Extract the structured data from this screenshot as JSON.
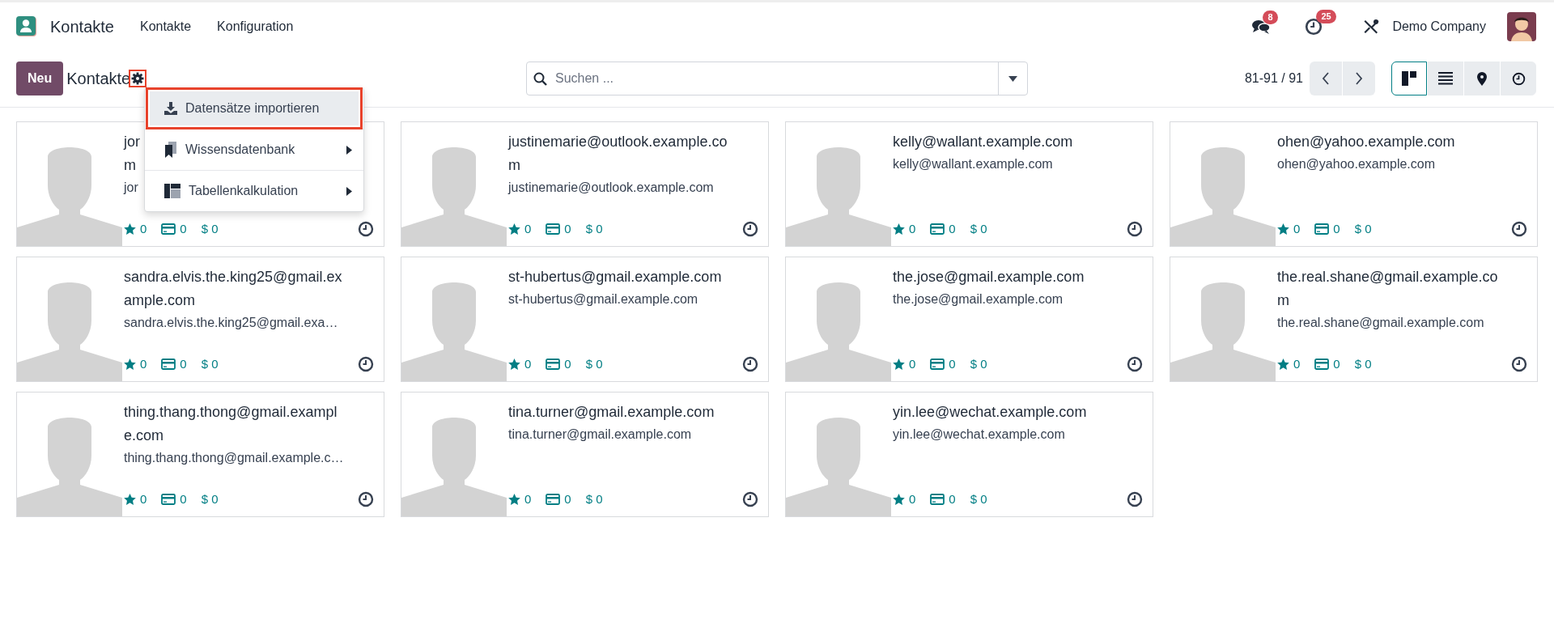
{
  "navbar": {
    "app_name": "Kontakte",
    "menus": [
      "Kontakte",
      "Konfiguration"
    ],
    "messages_badge": "8",
    "activities_badge": "25",
    "company": "Demo Company"
  },
  "control_panel": {
    "new_button": "Neu",
    "breadcrumb": "Kontakte",
    "gear_highlighted": true,
    "actions_menu": [
      {
        "kind": "import",
        "label": "Datensätze importieren",
        "selected": true,
        "highlighted": true,
        "submenu": false
      },
      {
        "kind": "knowledge",
        "label": "Wissensdatenbank",
        "selected": false,
        "highlighted": false,
        "submenu": true
      },
      {
        "kind": "spreadsheet",
        "label": "Tabellenkalkulation",
        "selected": false,
        "highlighted": false,
        "submenu": true
      }
    ],
    "search": {
      "placeholder": "Suchen ..."
    },
    "pager": "81-91 / 91",
    "views": [
      {
        "kind": "kanban",
        "selected": true
      },
      {
        "kind": "list",
        "selected": false
      },
      {
        "kind": "map",
        "selected": false
      },
      {
        "kind": "activity",
        "selected": false
      }
    ]
  },
  "contacts": [
    {
      "title_lines": [
        "jor",
        "m"
      ],
      "email": "jor",
      "stats": [
        {
          "kind": "star",
          "value": "0"
        },
        {
          "kind": "invoice",
          "value": "0"
        },
        {
          "kind": "sales",
          "symbol": "$",
          "value": "0"
        }
      ]
    },
    {
      "title_lines": [
        "justinemarie@outlook.example.co",
        "m"
      ],
      "email": "justinemarie@outlook.example.com",
      "stats": [
        {
          "kind": "star",
          "value": "0"
        },
        {
          "kind": "invoice",
          "value": "0"
        },
        {
          "kind": "sales",
          "symbol": "$",
          "value": "0"
        }
      ]
    },
    {
      "title_lines": [
        "kelly@wallant.example.com"
      ],
      "email": "kelly@wallant.example.com",
      "stats": [
        {
          "kind": "star",
          "value": "0"
        },
        {
          "kind": "invoice",
          "value": "0"
        },
        {
          "kind": "sales",
          "symbol": "$",
          "value": "0"
        }
      ]
    },
    {
      "title_lines": [
        "ohen@yahoo.example.com"
      ],
      "email": "ohen@yahoo.example.com",
      "stats": [
        {
          "kind": "star",
          "value": "0"
        },
        {
          "kind": "invoice",
          "value": "0"
        },
        {
          "kind": "sales",
          "symbol": "$",
          "value": "0"
        }
      ]
    },
    {
      "title_lines": [
        "sandra.elvis.the.king25@gmail.ex",
        "ample.com"
      ],
      "email": "sandra.elvis.the.king25@gmail.exa…",
      "stats": [
        {
          "kind": "star",
          "value": "0"
        },
        {
          "kind": "invoice",
          "value": "0"
        },
        {
          "kind": "sales",
          "symbol": "$",
          "value": "0"
        }
      ]
    },
    {
      "title_lines": [
        "st-hubertus@gmail.example.com"
      ],
      "email": "st-hubertus@gmail.example.com",
      "stats": [
        {
          "kind": "star",
          "value": "0"
        },
        {
          "kind": "invoice",
          "value": "0"
        },
        {
          "kind": "sales",
          "symbol": "$",
          "value": "0"
        }
      ]
    },
    {
      "title_lines": [
        "the.jose@gmail.example.com"
      ],
      "email": "the.jose@gmail.example.com",
      "stats": [
        {
          "kind": "star",
          "value": "0"
        },
        {
          "kind": "invoice",
          "value": "0"
        },
        {
          "kind": "sales",
          "symbol": "$",
          "value": "0"
        }
      ]
    },
    {
      "title_lines": [
        "the.real.shane@gmail.example.co",
        "m"
      ],
      "email": "the.real.shane@gmail.example.com",
      "stats": [
        {
          "kind": "star",
          "value": "0"
        },
        {
          "kind": "invoice",
          "value": "0"
        },
        {
          "kind": "sales",
          "symbol": "$",
          "value": "0"
        }
      ]
    },
    {
      "title_lines": [
        "thing.thang.thong@gmail.exampl",
        "e.com"
      ],
      "email": "thing.thang.thong@gmail.example.c…",
      "stats": [
        {
          "kind": "star",
          "value": "0"
        },
        {
          "kind": "invoice",
          "value": "0"
        },
        {
          "kind": "sales",
          "symbol": "$",
          "value": "0"
        }
      ]
    },
    {
      "title_lines": [
        "tina.turner@gmail.example.com"
      ],
      "email": "tina.turner@gmail.example.com",
      "stats": [
        {
          "kind": "star",
          "value": "0"
        },
        {
          "kind": "invoice",
          "value": "0"
        },
        {
          "kind": "sales",
          "symbol": "$",
          "value": "0"
        }
      ]
    },
    {
      "title_lines": [
        "yin.lee@wechat.example.com"
      ],
      "email": "yin.lee@wechat.example.com",
      "stats": [
        {
          "kind": "star",
          "value": "0"
        },
        {
          "kind": "invoice",
          "value": "0"
        },
        {
          "kind": "sales",
          "symbol": "$",
          "value": "0"
        }
      ]
    }
  ]
}
